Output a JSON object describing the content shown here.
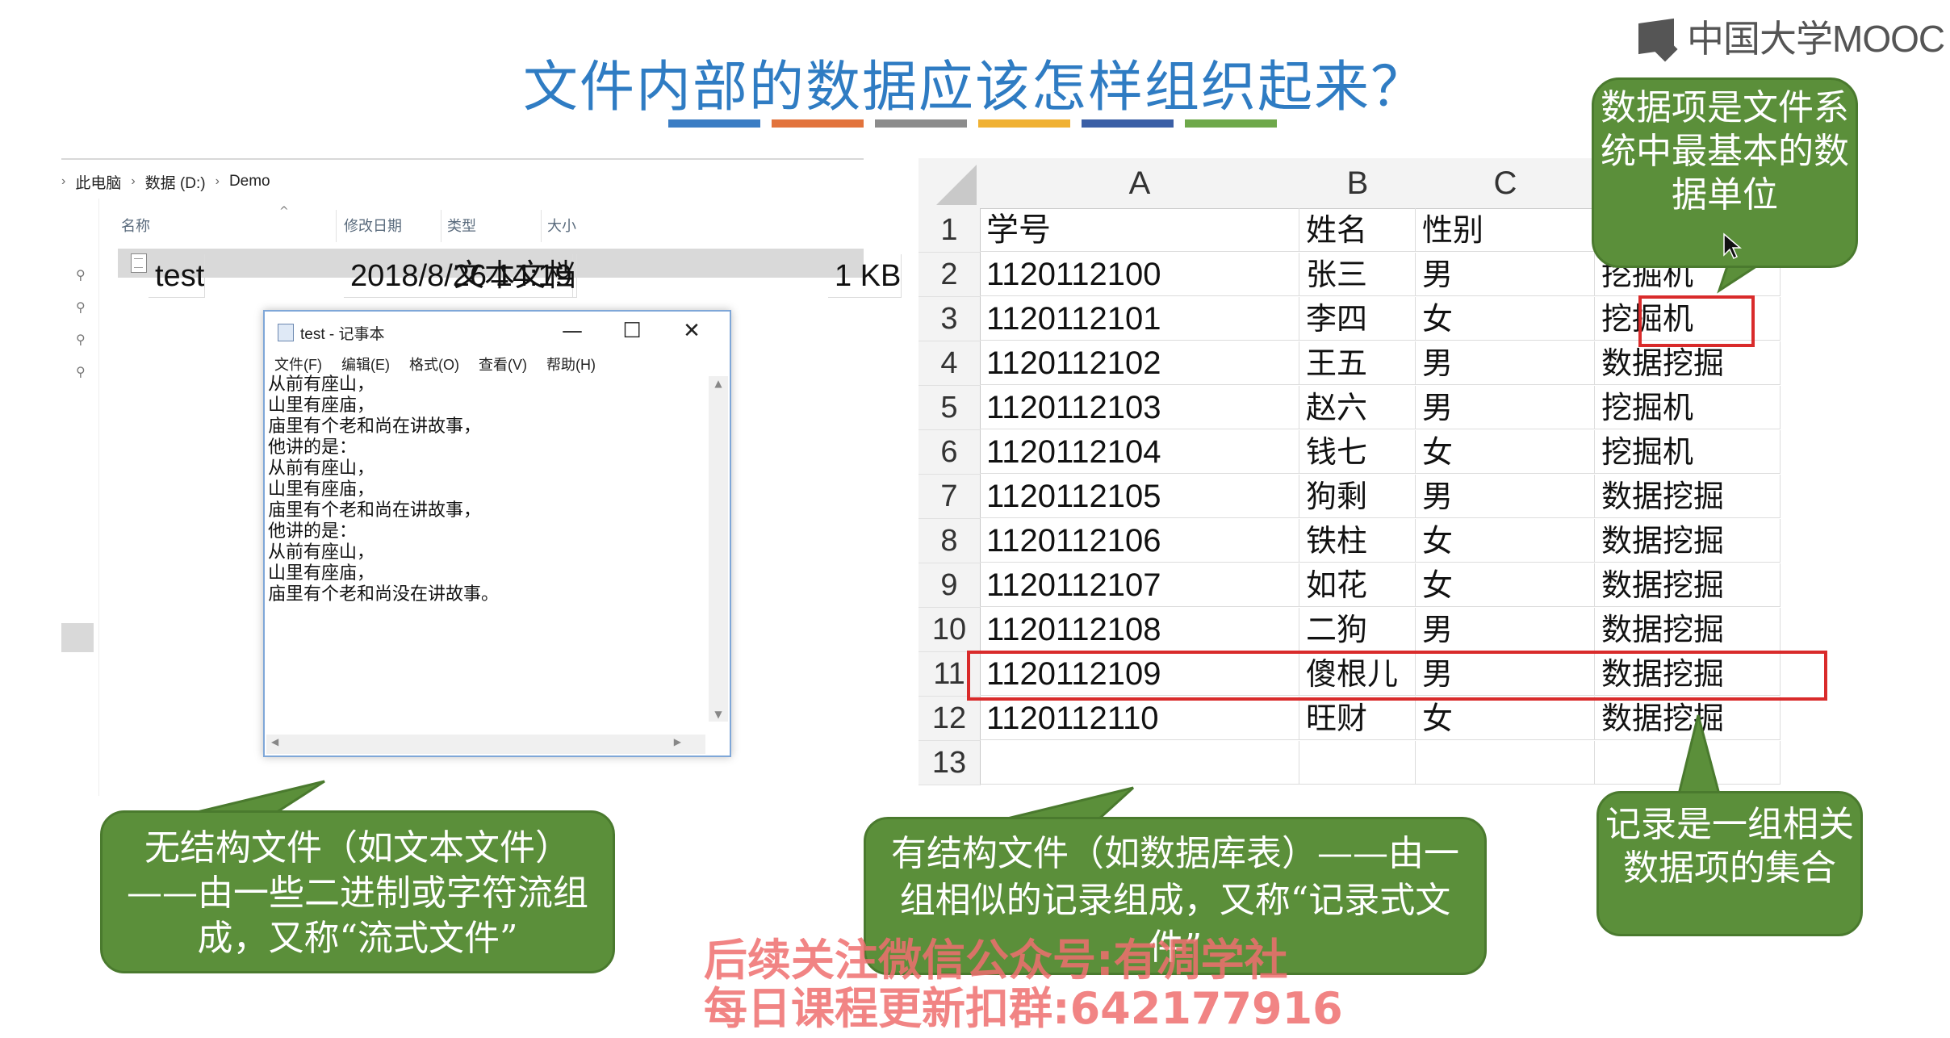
{
  "title": "文件内部的数据应该怎样组织起来？",
  "logo": {
    "text": "中国大学MOOC",
    "icon": "mooc-logo-icon"
  },
  "color_bars": [
    "#3b7dc4",
    "#e2733c",
    "#8c8c8c",
    "#f0b133",
    "#3b5fa6",
    "#6ea84a"
  ],
  "explorer": {
    "breadcrumb": [
      "此电脑",
      "数据 (D:)",
      "Demo"
    ],
    "columns": {
      "name": "名称",
      "modified": "修改日期",
      "type": "类型",
      "size": "大小"
    },
    "file": {
      "name": "test",
      "modified": "2018/8/26 14:19",
      "type": "文本文档",
      "size": "1 KB"
    }
  },
  "notepad": {
    "title": "test - 记事本",
    "controls": {
      "minimize": "—",
      "maximize": "☐",
      "close": "✕"
    },
    "menu": [
      "文件(F)",
      "编辑(E)",
      "格式(O)",
      "查看(V)",
      "帮助(H)"
    ],
    "text": "从前有座山，\n山里有座庙，\n庙里有个老和尚在讲故事，\n他讲的是：\n从前有座山，\n山里有座庙，\n庙里有个老和尚在讲故事，\n他讲的是：\n从前有座山，\n山里有座庙，\n庙里有个老和尚没在讲故事。"
  },
  "sheet": {
    "columns": [
      "A",
      "B",
      "C",
      ""
    ],
    "rows": [
      {
        "n": "1",
        "a": "学号",
        "b": "姓名",
        "c": "性别",
        "d": ""
      },
      {
        "n": "2",
        "a": "1120112100",
        "b": "张三",
        "c": "男",
        "d": "挖掘机"
      },
      {
        "n": "3",
        "a": "1120112101",
        "b": "李四",
        "c": "女",
        "d": "挖掘机"
      },
      {
        "n": "4",
        "a": "1120112102",
        "b": "王五",
        "c": "男",
        "d": "数据挖掘"
      },
      {
        "n": "5",
        "a": "1120112103",
        "b": "赵六",
        "c": "男",
        "d": "挖掘机"
      },
      {
        "n": "6",
        "a": "1120112104",
        "b": "钱七",
        "c": "女",
        "d": "挖掘机"
      },
      {
        "n": "7",
        "a": "1120112105",
        "b": "狗剩",
        "c": "男",
        "d": "数据挖掘"
      },
      {
        "n": "8",
        "a": "1120112106",
        "b": "铁柱",
        "c": "女",
        "d": "数据挖掘"
      },
      {
        "n": "9",
        "a": "1120112107",
        "b": "如花",
        "c": "女",
        "d": "数据挖掘"
      },
      {
        "n": "10",
        "a": "1120112108",
        "b": "二狗",
        "c": "男",
        "d": "数据挖掘"
      },
      {
        "n": "11",
        "a": "1120112109",
        "b": "傻根儿",
        "c": "男",
        "d": "数据挖掘"
      },
      {
        "n": "12",
        "a": "1120112110",
        "b": "旺财",
        "c": "女",
        "d": "数据挖掘"
      },
      {
        "n": "13",
        "a": "",
        "b": "",
        "c": "",
        "d": ""
      }
    ]
  },
  "callouts": {
    "data_field": "数据项是文件系统中最基本的数据单位",
    "record": "记录是一组相关数据项的集合",
    "unstructured": "无结构文件（如文本文件）——由一些二进制或字符流组成，又称“流式文件”",
    "structured": "有结构文件（如数据库表）——由一组相似的记录组成，又称“记录式文件”"
  },
  "watermark": {
    "line1": "后续关注微信公众号:有凋学社",
    "line2": "每日课程更新扣群:642177916"
  },
  "colors": {
    "title": "#2f7cc3",
    "callout": "#5b8f3a",
    "highlight": "#d92b2b",
    "watermark": "#ef6f6f"
  }
}
